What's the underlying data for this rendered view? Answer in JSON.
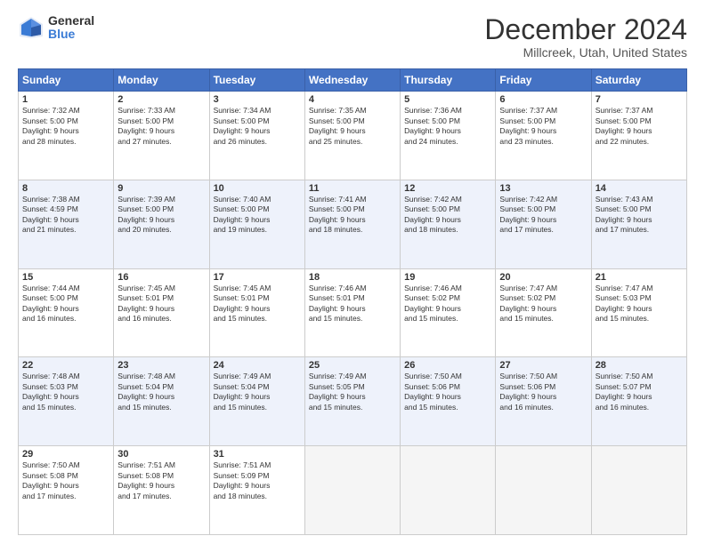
{
  "header": {
    "logo_general": "General",
    "logo_blue": "Blue",
    "month": "December 2024",
    "location": "Millcreek, Utah, United States"
  },
  "weekdays": [
    "Sunday",
    "Monday",
    "Tuesday",
    "Wednesday",
    "Thursday",
    "Friday",
    "Saturday"
  ],
  "weeks": [
    [
      {
        "day": 1,
        "info": "Sunrise: 7:32 AM\nSunset: 5:00 PM\nDaylight: 9 hours\nand 28 minutes."
      },
      {
        "day": 2,
        "info": "Sunrise: 7:33 AM\nSunset: 5:00 PM\nDaylight: 9 hours\nand 27 minutes."
      },
      {
        "day": 3,
        "info": "Sunrise: 7:34 AM\nSunset: 5:00 PM\nDaylight: 9 hours\nand 26 minutes."
      },
      {
        "day": 4,
        "info": "Sunrise: 7:35 AM\nSunset: 5:00 PM\nDaylight: 9 hours\nand 25 minutes."
      },
      {
        "day": 5,
        "info": "Sunrise: 7:36 AM\nSunset: 5:00 PM\nDaylight: 9 hours\nand 24 minutes."
      },
      {
        "day": 6,
        "info": "Sunrise: 7:37 AM\nSunset: 5:00 PM\nDaylight: 9 hours\nand 23 minutes."
      },
      {
        "day": 7,
        "info": "Sunrise: 7:37 AM\nSunset: 5:00 PM\nDaylight: 9 hours\nand 22 minutes."
      }
    ],
    [
      {
        "day": 8,
        "info": "Sunrise: 7:38 AM\nSunset: 4:59 PM\nDaylight: 9 hours\nand 21 minutes."
      },
      {
        "day": 9,
        "info": "Sunrise: 7:39 AM\nSunset: 5:00 PM\nDaylight: 9 hours\nand 20 minutes."
      },
      {
        "day": 10,
        "info": "Sunrise: 7:40 AM\nSunset: 5:00 PM\nDaylight: 9 hours\nand 19 minutes."
      },
      {
        "day": 11,
        "info": "Sunrise: 7:41 AM\nSunset: 5:00 PM\nDaylight: 9 hours\nand 18 minutes."
      },
      {
        "day": 12,
        "info": "Sunrise: 7:42 AM\nSunset: 5:00 PM\nDaylight: 9 hours\nand 18 minutes."
      },
      {
        "day": 13,
        "info": "Sunrise: 7:42 AM\nSunset: 5:00 PM\nDaylight: 9 hours\nand 17 minutes."
      },
      {
        "day": 14,
        "info": "Sunrise: 7:43 AM\nSunset: 5:00 PM\nDaylight: 9 hours\nand 17 minutes."
      }
    ],
    [
      {
        "day": 15,
        "info": "Sunrise: 7:44 AM\nSunset: 5:00 PM\nDaylight: 9 hours\nand 16 minutes."
      },
      {
        "day": 16,
        "info": "Sunrise: 7:45 AM\nSunset: 5:01 PM\nDaylight: 9 hours\nand 16 minutes."
      },
      {
        "day": 17,
        "info": "Sunrise: 7:45 AM\nSunset: 5:01 PM\nDaylight: 9 hours\nand 15 minutes."
      },
      {
        "day": 18,
        "info": "Sunrise: 7:46 AM\nSunset: 5:01 PM\nDaylight: 9 hours\nand 15 minutes."
      },
      {
        "day": 19,
        "info": "Sunrise: 7:46 AM\nSunset: 5:02 PM\nDaylight: 9 hours\nand 15 minutes."
      },
      {
        "day": 20,
        "info": "Sunrise: 7:47 AM\nSunset: 5:02 PM\nDaylight: 9 hours\nand 15 minutes."
      },
      {
        "day": 21,
        "info": "Sunrise: 7:47 AM\nSunset: 5:03 PM\nDaylight: 9 hours\nand 15 minutes."
      }
    ],
    [
      {
        "day": 22,
        "info": "Sunrise: 7:48 AM\nSunset: 5:03 PM\nDaylight: 9 hours\nand 15 minutes."
      },
      {
        "day": 23,
        "info": "Sunrise: 7:48 AM\nSunset: 5:04 PM\nDaylight: 9 hours\nand 15 minutes."
      },
      {
        "day": 24,
        "info": "Sunrise: 7:49 AM\nSunset: 5:04 PM\nDaylight: 9 hours\nand 15 minutes."
      },
      {
        "day": 25,
        "info": "Sunrise: 7:49 AM\nSunset: 5:05 PM\nDaylight: 9 hours\nand 15 minutes."
      },
      {
        "day": 26,
        "info": "Sunrise: 7:50 AM\nSunset: 5:06 PM\nDaylight: 9 hours\nand 15 minutes."
      },
      {
        "day": 27,
        "info": "Sunrise: 7:50 AM\nSunset: 5:06 PM\nDaylight: 9 hours\nand 16 minutes."
      },
      {
        "day": 28,
        "info": "Sunrise: 7:50 AM\nSunset: 5:07 PM\nDaylight: 9 hours\nand 16 minutes."
      }
    ],
    [
      {
        "day": 29,
        "info": "Sunrise: 7:50 AM\nSunset: 5:08 PM\nDaylight: 9 hours\nand 17 minutes."
      },
      {
        "day": 30,
        "info": "Sunrise: 7:51 AM\nSunset: 5:08 PM\nDaylight: 9 hours\nand 17 minutes."
      },
      {
        "day": 31,
        "info": "Sunrise: 7:51 AM\nSunset: 5:09 PM\nDaylight: 9 hours\nand 18 minutes."
      },
      null,
      null,
      null,
      null
    ]
  ]
}
